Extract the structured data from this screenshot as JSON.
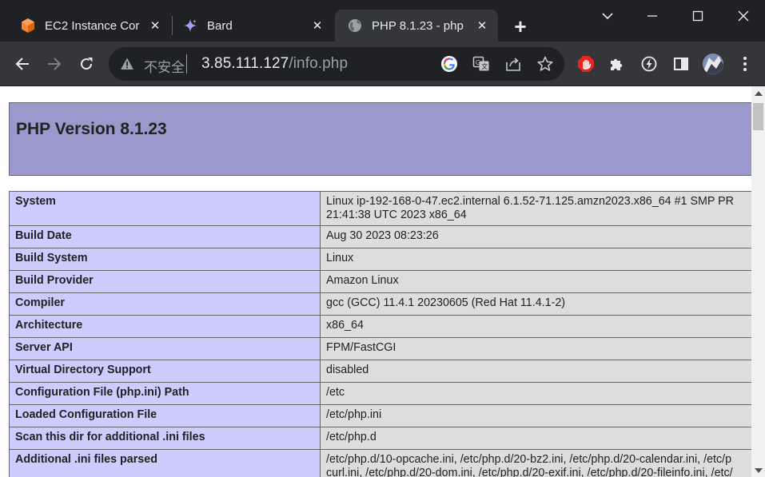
{
  "browser": {
    "tabs": [
      {
        "title": "EC2 Instance Cor",
        "icon": "aws-ec2-icon",
        "active": false
      },
      {
        "title": "Bard",
        "icon": "bard-sparkle-icon",
        "active": false
      },
      {
        "title": "PHP 8.1.23 - php",
        "icon": "globe-icon",
        "active": true
      }
    ],
    "new_tab_label": "+",
    "address": {
      "security_label": "不安全",
      "url_host": "3.85.111.127",
      "url_path": "/info.php"
    },
    "colors": {
      "titlebar": "#202124",
      "toolbar": "#35363a",
      "omnibox": "#202124"
    }
  },
  "page": {
    "title": "PHP Version 8.1.23",
    "colors": {
      "header_bg": "#9999cc",
      "label_bg": "#ccccff",
      "value_bg": "#dddddd"
    },
    "rows": [
      {
        "label": "System",
        "value": [
          "Linux ip-192-168-0-47.ec2.internal 6.1.52-71.125.amzn2023.x86_64 #1 SMP PR",
          "21:41:38 UTC 2023 x86_64"
        ]
      },
      {
        "label": "Build Date",
        "value": [
          "Aug 30 2023 08:23:26"
        ]
      },
      {
        "label": "Build System",
        "value": [
          "Linux"
        ]
      },
      {
        "label": "Build Provider",
        "value": [
          "Amazon Linux"
        ]
      },
      {
        "label": "Compiler",
        "value": [
          "gcc (GCC) 11.4.1 20230605 (Red Hat 11.4.1-2)"
        ]
      },
      {
        "label": "Architecture",
        "value": [
          "x86_64"
        ]
      },
      {
        "label": "Server API",
        "value": [
          "FPM/FastCGI"
        ]
      },
      {
        "label": "Virtual Directory Support",
        "value": [
          "disabled"
        ]
      },
      {
        "label": "Configuration File (php.ini) Path",
        "value": [
          "/etc"
        ]
      },
      {
        "label": "Loaded Configuration File",
        "value": [
          "/etc/php.ini"
        ]
      },
      {
        "label": "Scan this dir for additional .ini files",
        "value": [
          "/etc/php.d"
        ]
      },
      {
        "label": "Additional .ini files parsed",
        "value": [
          "/etc/php.d/10-opcache.ini, /etc/php.d/20-bz2.ini, /etc/php.d/20-calendar.ini, /etc/p",
          "curl.ini, /etc/php.d/20-dom.ini, /etc/php.d/20-exif.ini, /etc/php.d/20-fileinfo.ini, /etc/"
        ]
      }
    ]
  }
}
